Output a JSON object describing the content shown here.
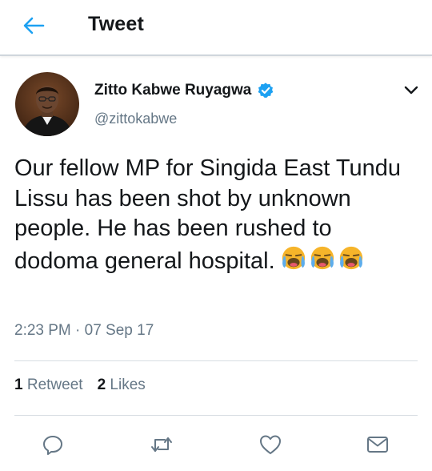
{
  "header": {
    "title": "Tweet",
    "back_icon": "arrow-left-icon"
  },
  "author": {
    "name": "Zitto Kabwe Ruyagwa",
    "handle": "@zittokabwe",
    "verified": true
  },
  "tweet": {
    "text": "Our fellow MP for Singida East Tundu Lissu has been shot by unknown people. He has been rushed to dodoma general hospital.",
    "emojis": [
      "loudly-crying-face",
      "loudly-crying-face",
      "loudly-crying-face"
    ],
    "timestamp": "2:23 PM · 07 Sep 17"
  },
  "stats": {
    "retweets_count": "1",
    "retweets_label": "Retweet",
    "likes_count": "2",
    "likes_label": "Likes"
  },
  "actions": [
    "reply-icon",
    "retweet-icon",
    "like-icon",
    "share-icon"
  ],
  "colors": {
    "accent": "#1da1f2",
    "text": "#14171a",
    "secondary": "#657786",
    "divider": "#d7dde2"
  }
}
